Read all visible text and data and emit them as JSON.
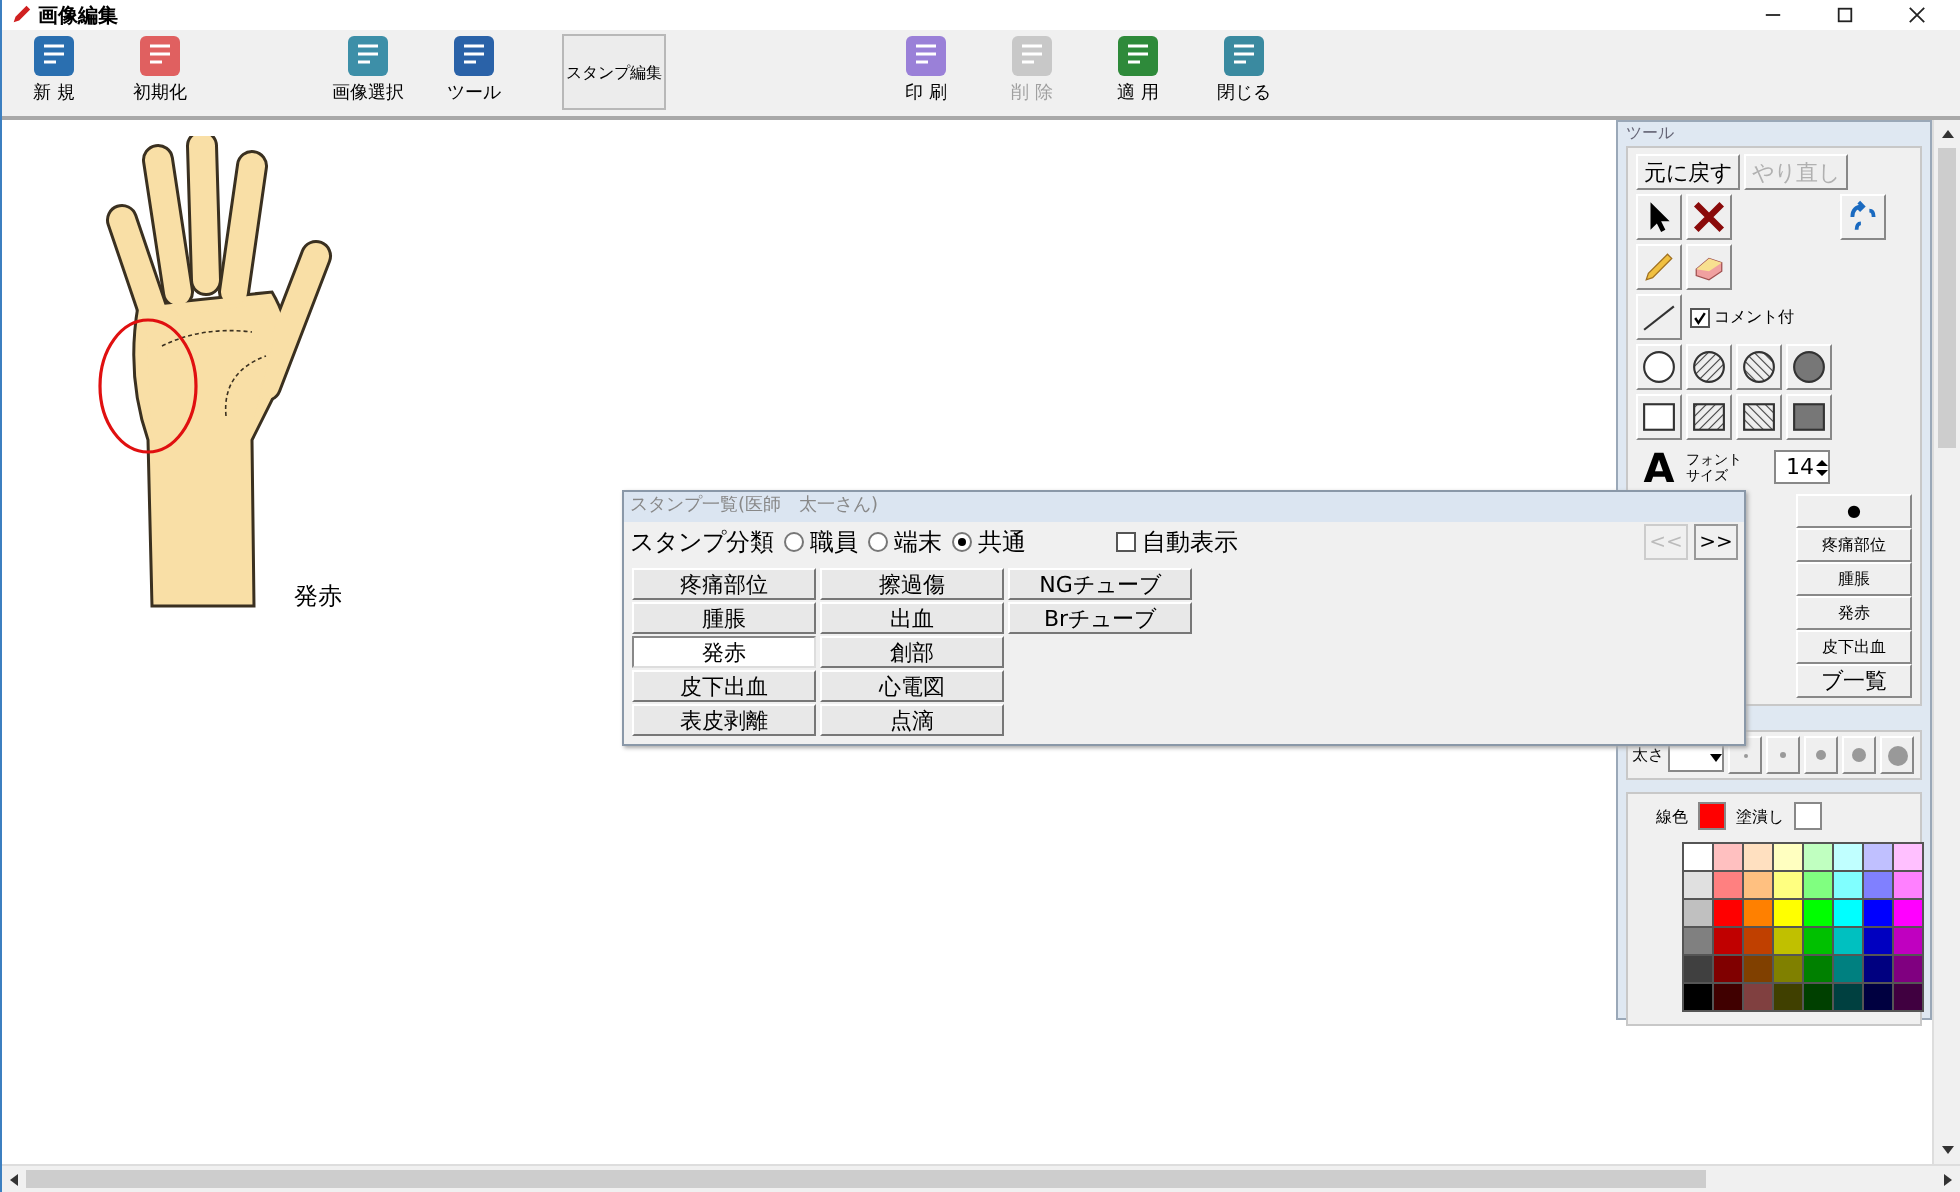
{
  "window": {
    "title": "画像編集"
  },
  "toolbar": {
    "left": [
      {
        "label": "新 規",
        "disabled": false
      },
      {
        "label": "初期化",
        "disabled": false
      },
      {
        "label": "画像選択",
        "disabled": false
      },
      {
        "label": "ツール",
        "disabled": false
      }
    ],
    "stamp_edit": {
      "label": "スタンプ編集",
      "pressed": true
    },
    "right": [
      {
        "label": "印 刷",
        "disabled": false
      },
      {
        "label": "削 除",
        "disabled": true
      },
      {
        "label": "適 用",
        "disabled": false
      },
      {
        "label": "閉じる",
        "disabled": false
      }
    ]
  },
  "canvas": {
    "stamp_label": "発赤"
  },
  "tool_panel": {
    "title": "ツール",
    "undo": {
      "label": "元に戻す",
      "disabled": false
    },
    "redo": {
      "label": "やり直し",
      "disabled": true
    },
    "comment": {
      "label": "コメント付",
      "checked": true
    },
    "font_glyph": "A",
    "font_label": "フォントサイズ",
    "font_size": "14",
    "dot_button": "●",
    "stamps": [
      "疼痛部位",
      "腫脹",
      "発赤",
      "皮下出血"
    ],
    "list_button": "ブ一覧",
    "thickness_label": "太さ",
    "line_color": {
      "label": "線色",
      "color": "#ff0000"
    },
    "fill_color": {
      "label": "塗潰し",
      "color": "#ffffff"
    },
    "palette": [
      {
        "color": "#ffffff"
      },
      {
        "color": "#ffc0c0"
      },
      {
        "color": "#ffe0c0"
      },
      {
        "color": "#ffffc0"
      },
      {
        "color": "#c0ffc0"
      },
      {
        "color": "#c0ffff"
      },
      {
        "color": "#c0c0ff"
      },
      {
        "color": "#ffc0ff"
      },
      {
        "color": "#e0e0e0"
      },
      {
        "color": "#ff8080"
      },
      {
        "color": "#ffc080"
      },
      {
        "color": "#ffff80"
      },
      {
        "color": "#80ff80"
      },
      {
        "color": "#80ffff"
      },
      {
        "color": "#8080ff"
      },
      {
        "color": "#ff80ff"
      },
      {
        "color": "#c0c0c0"
      },
      {
        "color": "#ff0000"
      },
      {
        "color": "#ff8000"
      },
      {
        "color": "#ffff00"
      },
      {
        "color": "#00ff00"
      },
      {
        "color": "#00ffff"
      },
      {
        "color": "#0000ff"
      },
      {
        "color": "#ff00ff"
      },
      {
        "color": "#808080"
      },
      {
        "color": "#c00000"
      },
      {
        "color": "#c04000"
      },
      {
        "color": "#c0c000"
      },
      {
        "color": "#00c000"
      },
      {
        "color": "#00c0c0"
      },
      {
        "color": "#0000c0"
      },
      {
        "color": "#c000c0"
      },
      {
        "color": "#404040"
      },
      {
        "color": "#800000"
      },
      {
        "color": "#804000"
      },
      {
        "color": "#808000"
      },
      {
        "color": "#008000"
      },
      {
        "color": "#008080"
      },
      {
        "color": "#000080"
      },
      {
        "color": "#800080"
      },
      {
        "color": "#000000"
      },
      {
        "color": "#400000"
      },
      {
        "color": "#804040"
      },
      {
        "color": "#404000"
      },
      {
        "color": "#004000"
      },
      {
        "color": "#004040"
      },
      {
        "color": "#000040"
      },
      {
        "color": "#400040"
      }
    ]
  },
  "stamp_dialog": {
    "title": "スタンプ一覧(医師　太一さん)",
    "category_label": "スタンプ分類",
    "categories": [
      {
        "label": "職員",
        "selected": false
      },
      {
        "label": "端末",
        "selected": false
      },
      {
        "label": "共通",
        "selected": true
      }
    ],
    "auto_show": {
      "label": "自動表示",
      "checked": false
    },
    "prev": {
      "label": "<<",
      "disabled": true
    },
    "next": {
      "label": ">>",
      "disabled": false
    },
    "columns": [
      [
        {
          "label": "疼痛部位",
          "selected": false
        },
        {
          "label": "腫脹",
          "selected": false
        },
        {
          "label": "発赤",
          "selected": true
        },
        {
          "label": "皮下出血",
          "selected": false
        },
        {
          "label": "表皮剥離",
          "selected": false
        }
      ],
      [
        {
          "label": "擦過傷",
          "selected": false
        },
        {
          "label": "出血",
          "selected": false
        },
        {
          "label": "創部",
          "selected": false
        },
        {
          "label": "心電図",
          "selected": false
        },
        {
          "label": "点滴",
          "selected": false
        }
      ],
      [
        {
          "label": "NGチューブ",
          "selected": false
        },
        {
          "label": "Brチューブ",
          "selected": false
        }
      ]
    ]
  }
}
